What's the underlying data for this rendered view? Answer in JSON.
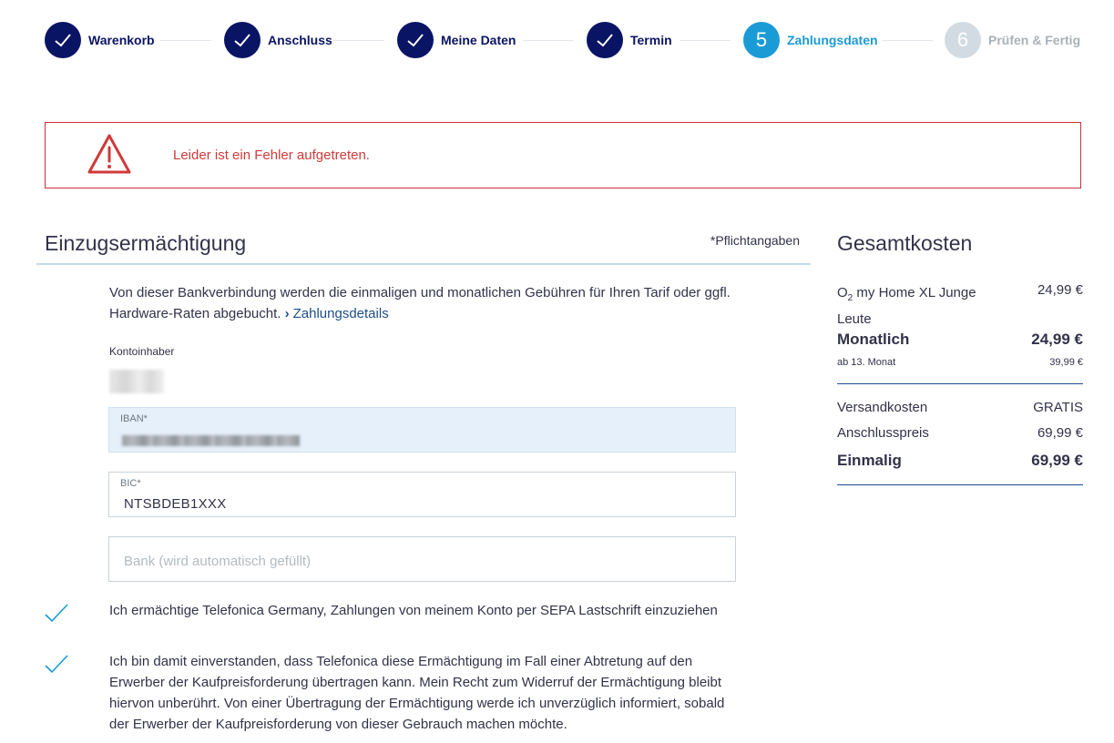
{
  "stepper": {
    "steps": [
      {
        "label": "Warenkorb",
        "state": "done"
      },
      {
        "label": "Anschluss",
        "state": "done"
      },
      {
        "label": "Meine Daten",
        "state": "done"
      },
      {
        "label": "Termin",
        "state": "done"
      },
      {
        "number": "5",
        "label": "Zahlungsdaten",
        "state": "active"
      },
      {
        "number": "6",
        "label": "Prüfen & Fertig",
        "state": "todo"
      }
    ]
  },
  "error": {
    "message": "Leider ist ein Fehler aufgetreten."
  },
  "form": {
    "title": "Einzugsermächtigung",
    "required_note": "*Pflichtangaben",
    "intro": "Von dieser Bankverbindung werden die einmaligen und monatlichen Gebühren für Ihren Tarif oder ggfl. Hardware-Raten abgebucht.",
    "intro_link": "Zahlungsdetails",
    "owner_label": "Kontoinhaber",
    "iban_label": "IBAN*",
    "bic_label": "BIC*",
    "bic_value": "NTSBDEB1XXX",
    "bank_placeholder": "Bank (wird automatisch gefüllt)",
    "consent_1": "Ich ermächtige Telefonica Germany, Zahlungen von meinem Konto per SEPA Lastschrift einzuziehen",
    "consent_2": "Ich bin damit einverstanden, dass Telefonica diese Ermächtigung im Fall einer Abtretung auf den Erwerber der Kaufpreisforderung übertragen kann. Mein Recht zum Widerruf der Ermächtigung bleibt hiervon unberührt. Von einer Übertragung der Ermächtigung werde ich unverzüglich informiert, sobald der Erwerber der Kaufpreisforderung von dieser Gebrauch machen möchte."
  },
  "summary": {
    "title": "Gesamtkosten",
    "tariff_prefix": "O",
    "tariff_sub": "2",
    "tariff_name": " my Home XL Junge Leute",
    "tariff_price": "24,99 €",
    "monthly_label": "Monatlich",
    "monthly_value": "24,99 €",
    "after_label": "ab 13. Monat",
    "after_value": "39,99 €",
    "shipping_label": "Versandkosten",
    "shipping_value": "GRATIS",
    "connection_label": "Anschlusspreis",
    "connection_value": "69,99 €",
    "onetime_label": "Einmalig",
    "onetime_value": "69,99 €"
  },
  "colors": {
    "brand_navy": "#0a1464",
    "active_blue": "#1b9bd6",
    "error_red": "#c8323c",
    "link_blue": "#1d4e89"
  }
}
